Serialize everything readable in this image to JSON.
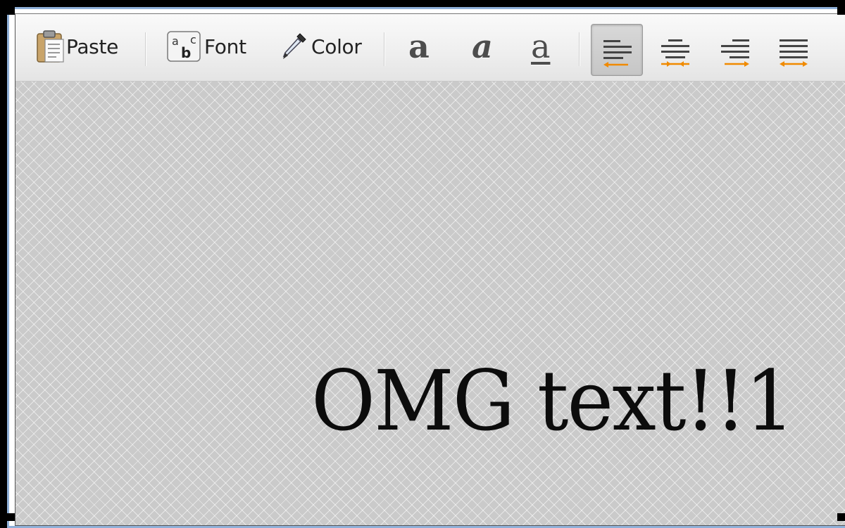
{
  "toolbar": {
    "paste": {
      "label": "Paste",
      "icon": "clipboard-icon"
    },
    "font": {
      "label": "Font",
      "icon": "font-abc-icon",
      "icon_letters": [
        "a",
        "b",
        "c"
      ]
    },
    "color": {
      "label": "Color",
      "icon": "eyedropper-icon"
    },
    "styles": [
      {
        "name": "bold",
        "glyph": "a",
        "icon": "bold-icon"
      },
      {
        "name": "italic",
        "glyph": "a",
        "icon": "italic-icon"
      },
      {
        "name": "underline",
        "glyph": "a",
        "icon": "underline-icon"
      }
    ],
    "alignment": [
      {
        "name": "align-left",
        "active": true
      },
      {
        "name": "align-center",
        "active": false
      },
      {
        "name": "align-right",
        "active": false
      },
      {
        "name": "justify",
        "active": false
      }
    ]
  },
  "canvas": {
    "text": "OMG text!!1"
  },
  "colors": {
    "accent_arrow": "#f08a00",
    "window_border": "#8fb0d8",
    "canvas_bg": "#cacaca"
  }
}
